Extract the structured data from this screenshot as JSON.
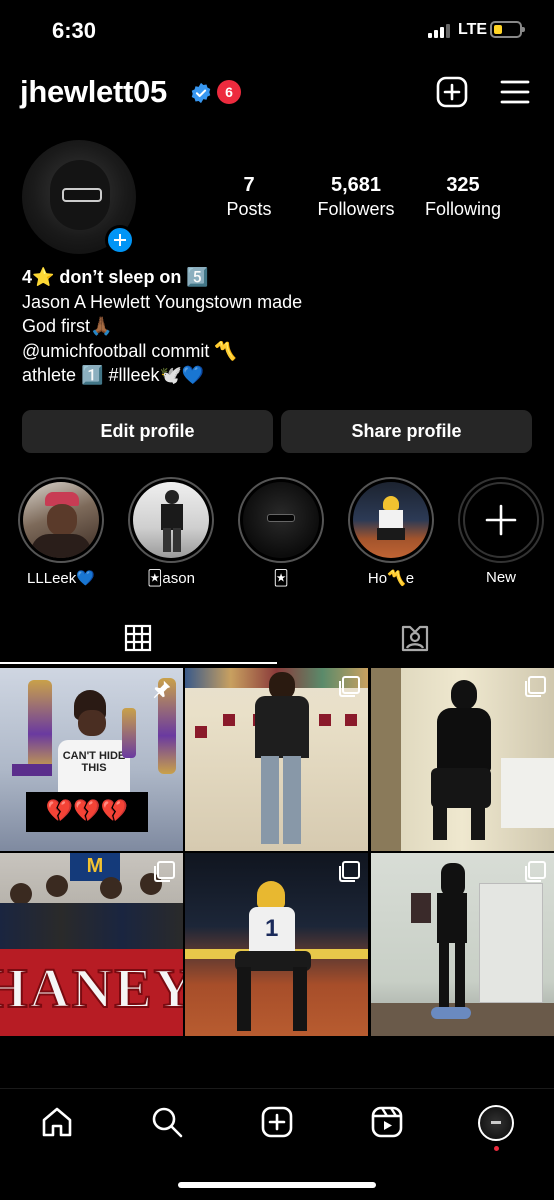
{
  "status_bar": {
    "time": "6:30",
    "network": "LTE",
    "battery_level": 0.35,
    "battery_color": "#ffd426"
  },
  "header": {
    "username": "jhewlett05",
    "notification_count": "6",
    "verified_color": "#3897f0",
    "badge_color": "#ed2b3e"
  },
  "stats": [
    {
      "value": "7",
      "label": "Posts"
    },
    {
      "value": "5,681",
      "label": "Followers"
    },
    {
      "value": "325",
      "label": "Following"
    }
  ],
  "bio": {
    "name": "4⭐ don’t sleep on 5️⃣",
    "lines": [
      "Jason A Hewlett Youngstown made",
      "God first🙏🏾",
      "@umichfootball commit 〽️",
      "athlete 1️⃣ #llleek🕊️💙"
    ]
  },
  "buttons": {
    "edit_profile": "Edit profile",
    "share_profile": "Share profile"
  },
  "highlights": [
    {
      "label": "LLLeek💙"
    },
    {
      "label": "🃏ason"
    },
    {
      "label": "🃏"
    },
    {
      "label": "Ho〽️e"
    },
    {
      "label": "New"
    }
  ],
  "tabs": [
    {
      "icon": "grid-icon",
      "selected": true
    },
    {
      "icon": "tagged-icon",
      "selected": false
    }
  ],
  "posts": [
    {
      "id": "post-1",
      "pinned": true,
      "multi": false,
      "caption_text": "💔💔💔",
      "shirt_text": "CAN'T HIDE THIS"
    },
    {
      "id": "post-2",
      "pinned": false,
      "multi": true
    },
    {
      "id": "post-3",
      "pinned": false,
      "multi": true
    },
    {
      "id": "post-4",
      "pinned": false,
      "multi": true,
      "banner_text": "HANEY"
    },
    {
      "id": "post-5",
      "pinned": false,
      "multi": true
    },
    {
      "id": "post-6",
      "pinned": false,
      "multi": true
    }
  ],
  "bottom_nav": [
    {
      "icon": "home-icon"
    },
    {
      "icon": "search-icon"
    },
    {
      "icon": "create-icon"
    },
    {
      "icon": "reels-icon"
    },
    {
      "icon": "profile-avatar-icon",
      "has_dot": true,
      "dot_color": "#ed2b3e"
    }
  ]
}
